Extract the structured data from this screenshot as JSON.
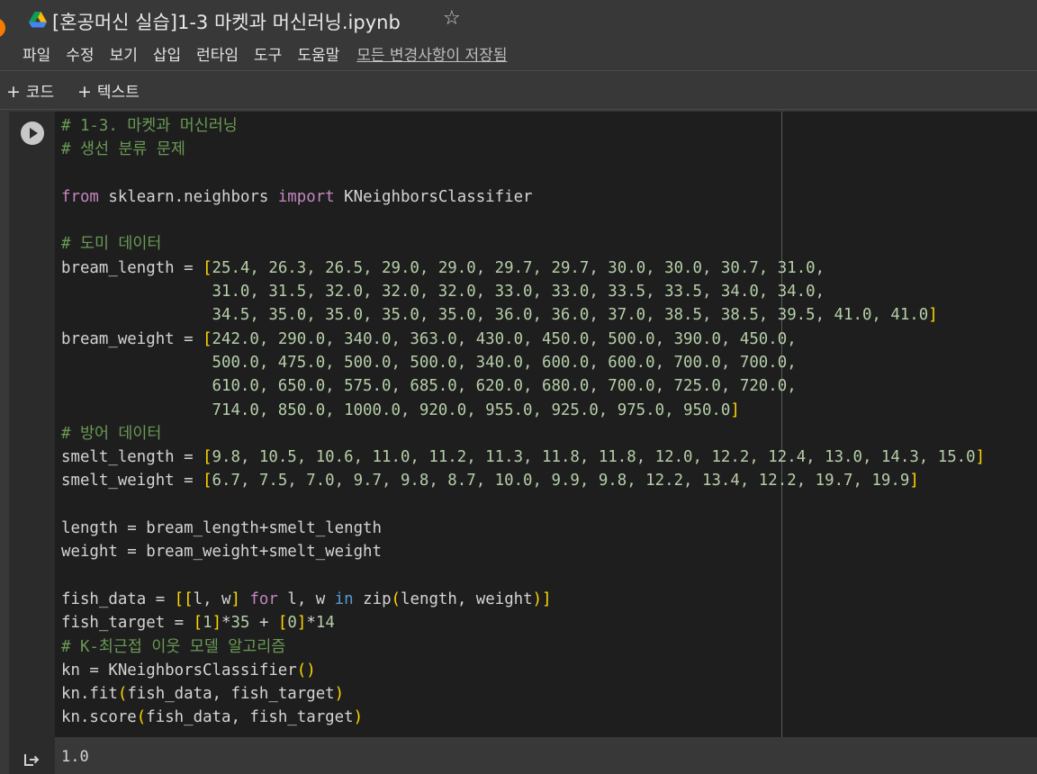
{
  "document": {
    "title": "[혼공머신 실습]1-3 마켓과 머신러닝.ipynb"
  },
  "menu": {
    "items": [
      "파일",
      "수정",
      "보기",
      "삽입",
      "런타임",
      "도구",
      "도움말"
    ],
    "save_status": "모든 변경사항이 저장됨"
  },
  "toolbar": {
    "add_code_label": "코드",
    "add_text_label": "텍스트"
  },
  "cell": {
    "lines": [
      [
        [
          "cm",
          "# 1-3. 마켓과 머신러닝"
        ]
      ],
      [
        [
          "cm",
          "# 생선 분류 문제"
        ]
      ],
      [],
      [
        [
          "kw",
          "from"
        ],
        [
          "",
          " sklearn.neighbors "
        ],
        [
          "kw",
          "import"
        ],
        [
          "",
          " KNeighborsClassifier"
        ]
      ],
      [],
      [
        [
          "cm",
          "# 도미 데이터"
        ]
      ],
      [
        [
          "",
          "bream_length = "
        ],
        [
          "br",
          "["
        ],
        [
          "num",
          "25.4, 26.3, 26.5, 29.0, 29.0, 29.7, 29.7, 30.0, 30.0, 30.7, 31.0,"
        ]
      ],
      [
        [
          "num",
          "                31.0, 31.5, 32.0, 32.0, 32.0, 33.0, 33.0, 33.5, 33.5, 34.0, 34.0,"
        ]
      ],
      [
        [
          "num",
          "                34.5, 35.0, 35.0, 35.0, 35.0, 36.0, 36.0, 37.0, 38.5, 38.5, 39.5, 41.0, 41.0"
        ],
        [
          "br",
          "]"
        ]
      ],
      [
        [
          "",
          "bream_weight = "
        ],
        [
          "br",
          "["
        ],
        [
          "num",
          "242.0, 290.0, 340.0, 363.0, 430.0, 450.0, 500.0, 390.0, 450.0,"
        ]
      ],
      [
        [
          "num",
          "                500.0, 475.0, 500.0, 500.0, 340.0, 600.0, 600.0, 700.0, 700.0,"
        ]
      ],
      [
        [
          "num",
          "                610.0, 650.0, 575.0, 685.0, 620.0, 680.0, 700.0, 725.0, 720.0,"
        ]
      ],
      [
        [
          "num",
          "                714.0, 850.0, 1000.0, 920.0, 955.0, 925.0, 975.0, 950.0"
        ],
        [
          "br",
          "]"
        ]
      ],
      [
        [
          "cm",
          "# 방어 데이터"
        ]
      ],
      [
        [
          "",
          "smelt_length = "
        ],
        [
          "br",
          "["
        ],
        [
          "num",
          "9.8, 10.5, 10.6, 11.0, 11.2, 11.3, 11.8, 11.8, 12.0, 12.2, 12.4, 13.0, 14.3, 15.0"
        ],
        [
          "br",
          "]"
        ]
      ],
      [
        [
          "",
          "smelt_weight = "
        ],
        [
          "br",
          "["
        ],
        [
          "num",
          "6.7, 7.5, 7.0, 9.7, 9.8, 8.7, 10.0, 9.9, 9.8, 12.2, 13.4, 12.2, 19.7, 19.9"
        ],
        [
          "br",
          "]"
        ]
      ],
      [],
      [
        [
          "",
          "length = bream_length+smelt_length"
        ]
      ],
      [
        [
          "",
          "weight = bream_weight+smelt_weight"
        ]
      ],
      [],
      [
        [
          "",
          "fish_data = "
        ],
        [
          "br",
          "[["
        ],
        [
          "",
          "l, w"
        ],
        [
          "br",
          "]"
        ],
        [
          "",
          " "
        ],
        [
          "kw",
          "for"
        ],
        [
          "",
          " l, w "
        ],
        [
          "kb",
          "in"
        ],
        [
          "",
          " zip"
        ],
        [
          "br",
          "("
        ],
        [
          "",
          "length, weight"
        ],
        [
          "br",
          ")]"
        ]
      ],
      [
        [
          "",
          "fish_target = "
        ],
        [
          "br",
          "["
        ],
        [
          "num",
          "1"
        ],
        [
          "br",
          "]"
        ],
        [
          "",
          "*"
        ],
        [
          "num",
          "35"
        ],
        [
          "",
          " + "
        ],
        [
          "br",
          "["
        ],
        [
          "num",
          "0"
        ],
        [
          "br",
          "]"
        ],
        [
          "",
          "*"
        ],
        [
          "num",
          "14"
        ]
      ],
      [
        [
          "cm",
          "# K-최근접 이웃 모델 알고리즘"
        ]
      ],
      [
        [
          "",
          "kn = KNeighborsClassifier"
        ],
        [
          "br",
          "()"
        ]
      ],
      [
        [
          "",
          "kn.fit"
        ],
        [
          "br",
          "("
        ],
        [
          "",
          "fish_data, fish_target"
        ],
        [
          "br",
          ")"
        ]
      ],
      [
        [
          "",
          "kn.score"
        ],
        [
          "br",
          "("
        ],
        [
          "",
          "fish_data, fish_target"
        ],
        [
          "br",
          ")"
        ]
      ]
    ]
  },
  "output": {
    "text": "1.0"
  },
  "icons": {
    "drive": "google-drive-icon",
    "star": "star-icon",
    "run": "play-icon",
    "output": "output-arrow-icon"
  }
}
